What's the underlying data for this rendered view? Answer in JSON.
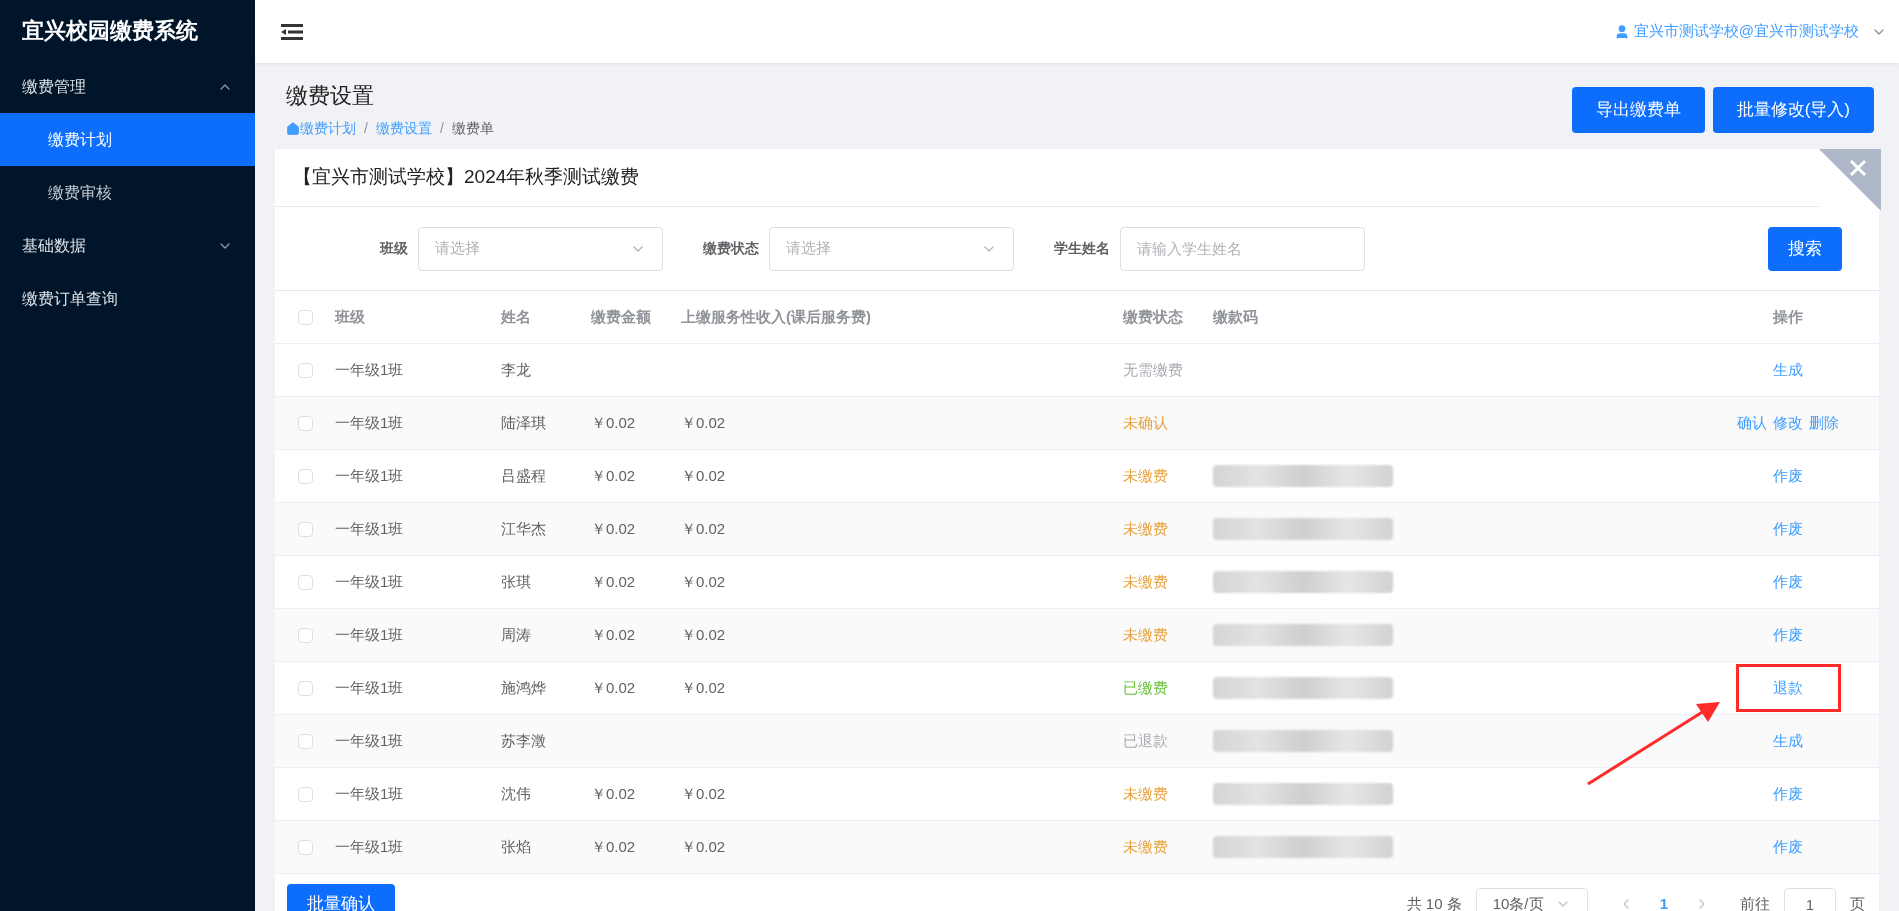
{
  "sidebar": {
    "title": "宜兴校园缴费系统",
    "items": [
      {
        "label": "缴费管理",
        "expanded": true,
        "children": [
          {
            "label": "缴费计划",
            "selected": true
          },
          {
            "label": "缴费审核",
            "selected": false
          }
        ]
      },
      {
        "label": "基础数据",
        "expanded": false
      },
      {
        "label": "缴费订单查询"
      }
    ]
  },
  "header": {
    "user": "宜兴市测试学校@宜兴市测试学校"
  },
  "page": {
    "title": "缴费设置",
    "breadcrumb": [
      {
        "label": "缴费计划",
        "link": true
      },
      {
        "separator": "/",
        "label": "缴费设置",
        "link": true
      },
      {
        "separator": "/",
        "label": "缴费单",
        "link": false
      }
    ],
    "buttons": [
      "导出缴费单",
      "批量修改(导入)"
    ]
  },
  "card": {
    "title": "【宜兴市测试学校】2024年秋季测试缴费",
    "filters": [
      {
        "label": "班级",
        "kind": "select",
        "placeholder": "请选择"
      },
      {
        "label": "缴费状态",
        "kind": "select",
        "placeholder": "请选择"
      },
      {
        "label": "学生姓名",
        "kind": "input",
        "placeholder": "请输入学生姓名"
      }
    ],
    "search_button": "搜索",
    "table": {
      "select_all_checked": false,
      "columns": [
        "班级",
        "姓名",
        "缴费金额",
        "上缴服务性收入(课后服务费)",
        "缴费状态",
        "缴款码",
        "操作"
      ],
      "rows": [
        {
          "checked": false,
          "class": "一年级1班",
          "name": "李龙",
          "amount": "",
          "service": "",
          "status": "无需缴费",
          "color": "#a8abb2",
          "redacted_code": false,
          "actions": [
            "生成"
          ],
          "highlighted": false
        },
        {
          "checked": false,
          "class": "一年级1班",
          "name": "陆泽琪",
          "amount": "￥0.02",
          "service": "￥0.02",
          "status": "未确认",
          "color": "#e6a23c",
          "redacted_code": false,
          "actions": [
            "确认",
            "修改",
            "删除"
          ],
          "highlighted": false
        },
        {
          "checked": false,
          "class": "一年级1班",
          "name": "吕盛程",
          "amount": "￥0.02",
          "service": "￥0.02",
          "status": "未缴费",
          "color": "#e6a23c",
          "redacted_code": true,
          "actions": [
            "作废"
          ],
          "highlighted": false
        },
        {
          "checked": false,
          "class": "一年级1班",
          "name": "江华杰",
          "amount": "￥0.02",
          "service": "￥0.02",
          "status": "未缴费",
          "color": "#e6a23c",
          "redacted_code": true,
          "actions": [
            "作废"
          ],
          "highlighted": false
        },
        {
          "checked": false,
          "class": "一年级1班",
          "name": "张琪",
          "amount": "￥0.02",
          "service": "￥0.02",
          "status": "未缴费",
          "color": "#e6a23c",
          "redacted_code": true,
          "actions": [
            "作废"
          ],
          "highlighted": false
        },
        {
          "checked": false,
          "class": "一年级1班",
          "name": "周涛",
          "amount": "￥0.02",
          "service": "￥0.02",
          "status": "未缴费",
          "color": "#e6a23c",
          "redacted_code": true,
          "actions": [
            "作废"
          ],
          "highlighted": false
        },
        {
          "checked": false,
          "class": "一年级1班",
          "name": "施鸿烨",
          "amount": "￥0.02",
          "service": "￥0.02",
          "status": "已缴费",
          "color": "#67c23a",
          "redacted_code": true,
          "actions": [
            "退款"
          ],
          "highlighted": true
        },
        {
          "checked": false,
          "class": "一年级1班",
          "name": "苏李澂",
          "amount": "",
          "service": "",
          "status": "已退款",
          "color": "#a8abb2",
          "redacted_code": true,
          "actions": [
            "生成"
          ],
          "highlighted": false
        },
        {
          "checked": false,
          "class": "一年级1班",
          "name": "沈伟",
          "amount": "￥0.02",
          "service": "￥0.02",
          "status": "未缴费",
          "color": "#e6a23c",
          "redacted_code": true,
          "actions": [
            "作废"
          ],
          "highlighted": false
        },
        {
          "checked": false,
          "class": "一年级1班",
          "name": "张焰",
          "amount": "￥0.02",
          "service": "￥0.02",
          "status": "未缴费",
          "color": "#e6a23c",
          "redacted_code": true,
          "actions": [
            "作废"
          ],
          "highlighted": false
        }
      ]
    },
    "batch_button": "批量确认",
    "pagination": {
      "total": "共 10 条",
      "page_size": "10条/页",
      "pages": [
        {
          "label": "1",
          "selected": true
        }
      ],
      "goto_label": "前往",
      "goto_value": "1",
      "goto_suffix": "页"
    }
  }
}
